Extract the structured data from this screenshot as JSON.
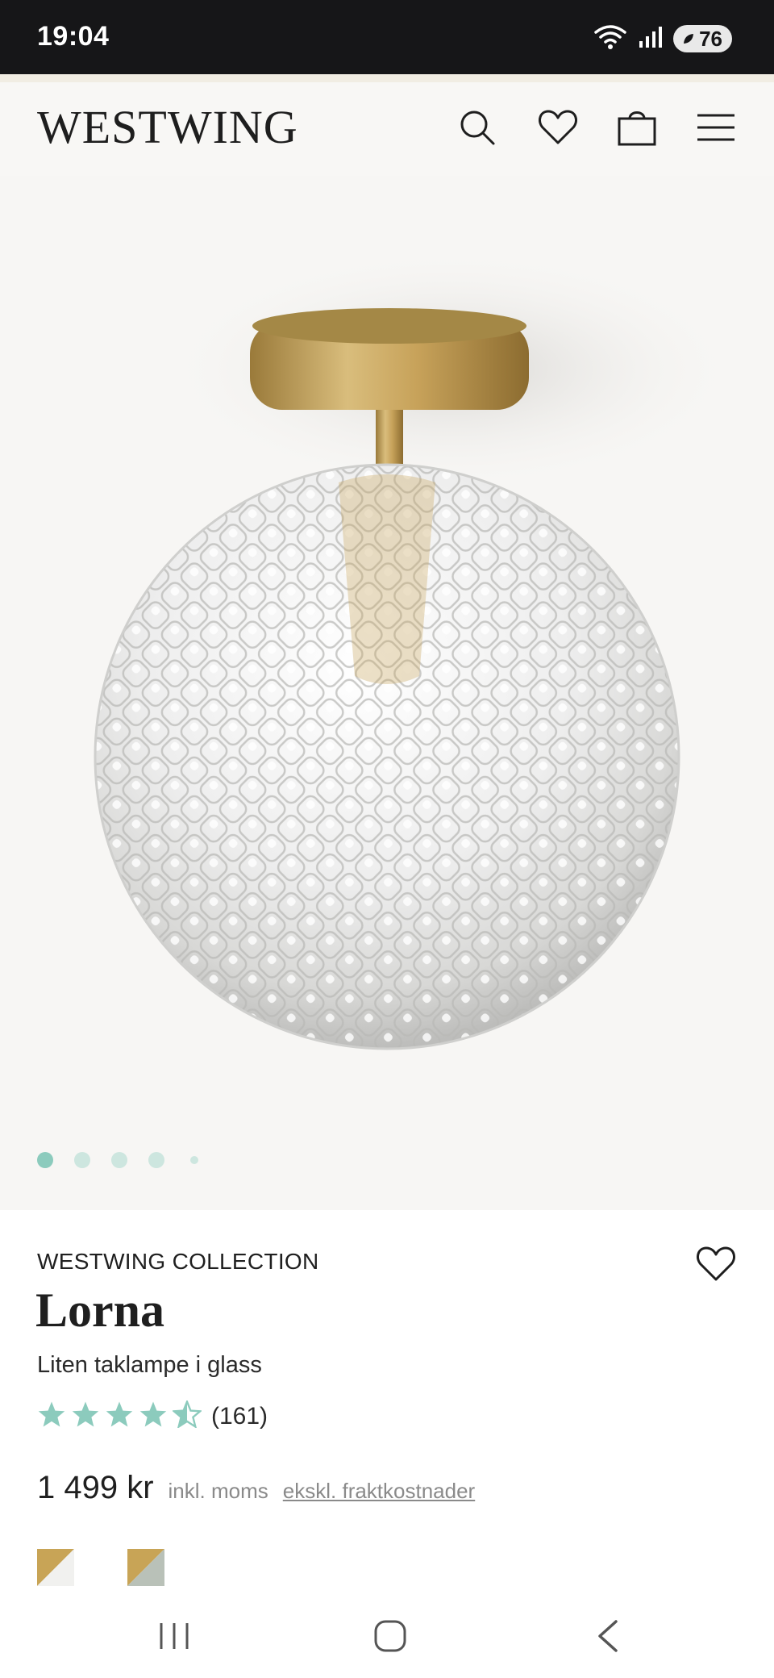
{
  "status_bar": {
    "time": "19:04",
    "battery": "76"
  },
  "header": {
    "logo": "WESTWING"
  },
  "carousel": {
    "dot_count": 5,
    "active_index": 0
  },
  "product": {
    "brand": "WESTWING COLLECTION",
    "name": "Lorna",
    "subtitle": "Liten taklampe i glass",
    "rating": 4.5,
    "rating_count": "(161)",
    "price": "1 499 kr",
    "vat_note": "inkl. moms",
    "shipping_note": "ekskl. fraktkostnader"
  },
  "colors": {
    "accent_star": "#8ccbbd",
    "brass": "#c8a456",
    "swatch_1_secondary": "#f1f1ef",
    "swatch_2_secondary": "#b9c1b8"
  }
}
